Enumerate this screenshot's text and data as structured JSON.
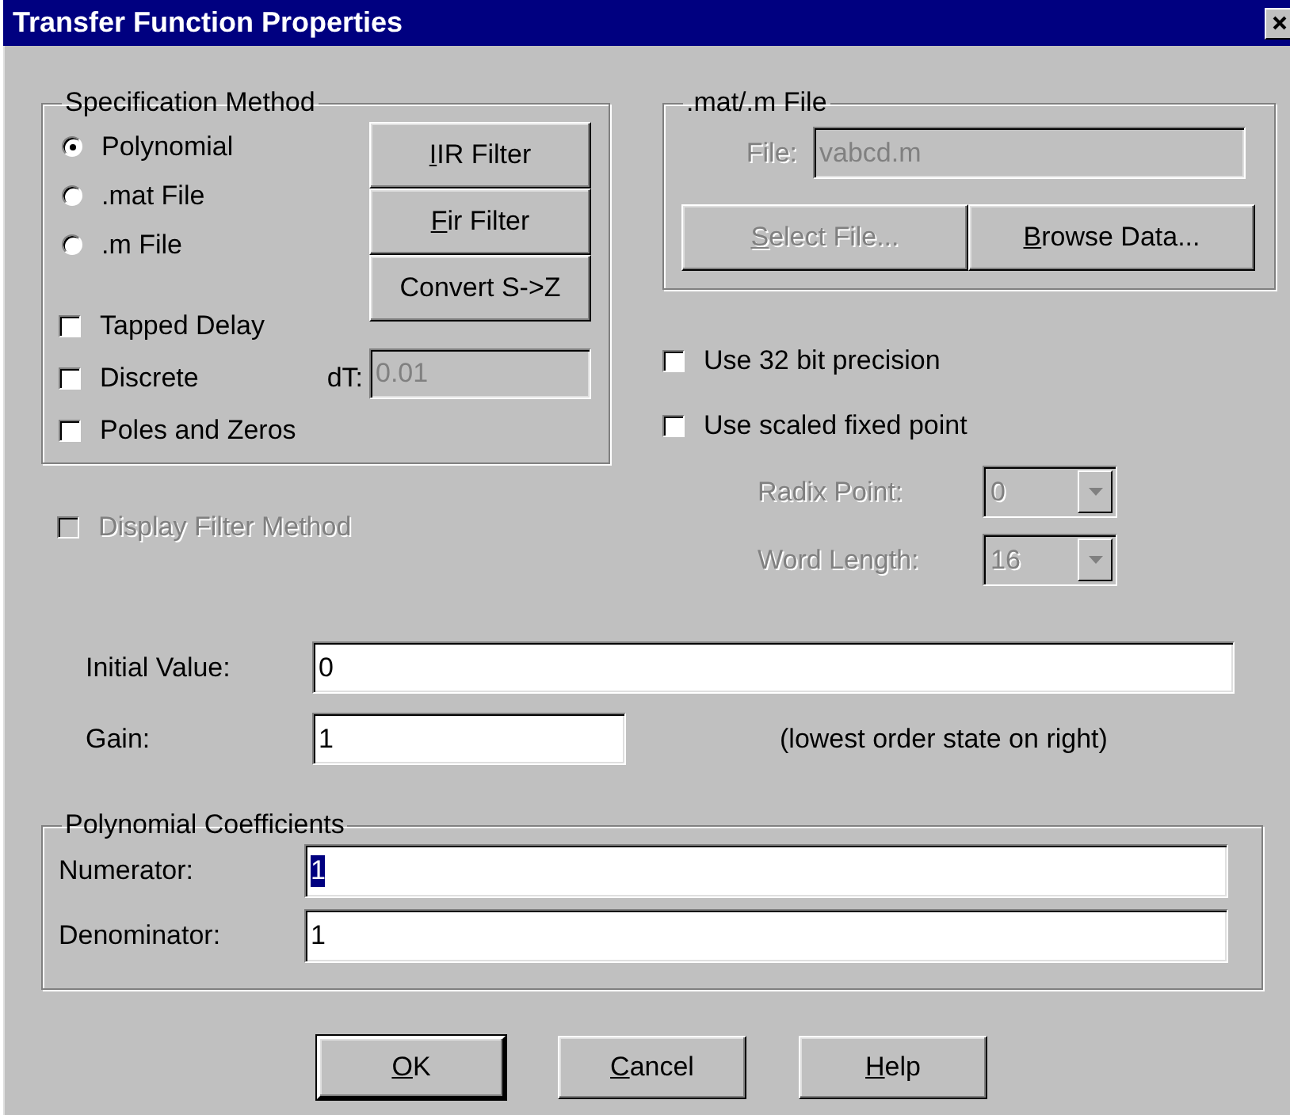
{
  "window": {
    "title": "Transfer Function Properties"
  },
  "specification_method": {
    "title": "Specification Method",
    "radios": [
      {
        "label": "Polynomial",
        "selected": true
      },
      {
        "label": ".mat File",
        "selected": false
      },
      {
        "label": ".m File",
        "selected": false
      }
    ],
    "buttons": [
      {
        "label": "IIR Filter",
        "mnemonic": true
      },
      {
        "label": "Fir Filter",
        "mnemonic": true
      },
      {
        "label": "Convert S->Z",
        "mnemonic": false
      }
    ],
    "checkboxes": [
      {
        "label": "Tapped Delay",
        "checked": false
      },
      {
        "label": "Discrete",
        "checked": false
      },
      {
        "label": "Poles and Zeros",
        "checked": false
      }
    ],
    "dt": {
      "label": "dT:",
      "value": "0.01",
      "disabled": true
    }
  },
  "file_group": {
    "title": ".mat/.m File",
    "file_label": "File:",
    "file_value": "vabcd.m",
    "disabled": true,
    "buttons": [
      {
        "label": "Select File...",
        "mnemonic": true,
        "disabled": true
      },
      {
        "label": "Browse Data...",
        "mnemonic": true,
        "disabled": false
      }
    ]
  },
  "options": [
    {
      "label": "Use 32 bit precision",
      "checked": false
    },
    {
      "label": "Use scaled fixed point",
      "checked": false
    }
  ],
  "fixed_point": [
    {
      "label": "Radix Point:",
      "value": "0",
      "disabled": true
    },
    {
      "label": "Word Length:",
      "value": "16",
      "disabled": true
    }
  ],
  "display_filter_method": {
    "label": "Display Filter Method",
    "checked": false,
    "disabled": true
  },
  "initial_value": {
    "label": "Initial Value:",
    "value": "0"
  },
  "gain": {
    "label": "Gain:",
    "value": "1"
  },
  "note": "(lowest order state on right)",
  "coefficients": {
    "title": "Polynomial Coefficients",
    "fields": [
      {
        "label": "Numerator:",
        "value": "1",
        "selected": true
      },
      {
        "label": "Denominator:",
        "value": "1",
        "selected": false
      }
    ]
  },
  "buttons": [
    {
      "label": "OK",
      "mnemonic": true,
      "default": true
    },
    {
      "label": "Cancel",
      "mnemonic": true,
      "default": false
    },
    {
      "label": "Help",
      "mnemonic": true,
      "default": false
    }
  ]
}
